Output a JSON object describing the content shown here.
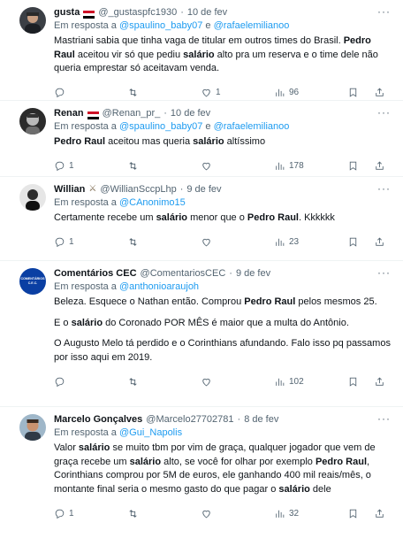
{
  "tweets": [
    {
      "name": "gusta",
      "handle": "@_gustaspfc1930",
      "sep": "·",
      "date": "10 de fev",
      "reply_prefix": "Em resposta a",
      "reply_to_1": "@spaulino_baby07",
      "reply_and": "e",
      "reply_to_2": "@rafaelemilianoo",
      "text": [
        "Mastriani sabia que tinha vaga de titular em outros times do Brasil. ",
        "Pedro Raul",
        " aceitou vir só que pediu ",
        "salário",
        " alto pra um reserva e o time dele não queria emprestar só aceitavam venda."
      ],
      "replies": "",
      "retweets": "",
      "likes": "1",
      "views": "96"
    },
    {
      "name": "Renan",
      "handle": "@Renan_pr_",
      "sep": "·",
      "date": "10 de fev",
      "reply_prefix": "Em resposta a",
      "reply_to_1": "@spaulino_baby07",
      "reply_and": "e",
      "reply_to_2": "@rafaelemilianoo",
      "text": [
        "Pedro Raul",
        " aceitou mas queria ",
        "salário",
        " altíssimo"
      ],
      "replies": "1",
      "retweets": "",
      "likes": "",
      "views": "178"
    },
    {
      "name": "Willian",
      "handle": "@WillianSccpLhp",
      "sep": "·",
      "date": "9 de fev",
      "reply_prefix": "Em resposta a",
      "reply_to_1": "@CAnonimo15",
      "text": [
        "Certamente recebe um ",
        "salário",
        " menor que o ",
        "Pedro Raul",
        ". Kkkkkk"
      ],
      "replies": "1",
      "retweets": "",
      "likes": "",
      "views": "23"
    },
    {
      "name": "Comentários CEC",
      "handle": "@ComentariosCEC",
      "sep": "·",
      "date": "9 de fev",
      "reply_prefix": "Em resposta a",
      "reply_to_1": "@anthonioaraujoh",
      "avatar_label": "COMENTÁRIOS C.E.C.",
      "p1": [
        "Beleza. Esquece o Nathan então. Comprou ",
        "Pedro Raul",
        " pelos mesmos 25."
      ],
      "p2": [
        "E o ",
        "salário",
        " do Coronado POR MÊS é maior que a multa do Antônio."
      ],
      "p3": "O Augusto Melo tá perdido e o Corinthians afundando. Falo isso pq passamos por isso aqui  em 2019.",
      "replies": "",
      "retweets": "",
      "likes": "",
      "views": "102"
    },
    {
      "name": "Marcelo Gonçalves",
      "handle": "@Marcelo27702781",
      "sep": "·",
      "date": "8 de fev",
      "reply_prefix": "Em resposta a",
      "reply_to_1": "@Gui_Napolis",
      "text": [
        "Valor ",
        "salário",
        " se muito tbm por vim de graça, qualquer jogador que vem de graça recebe um ",
        "salário",
        " alto, se você for olhar por exemplo ",
        "Pedro Raul",
        ", Corinthians comprou por 5M de euros, ele ganhando 400 mil reais/mês, o montante final seria o mesmo gasto do que pagar o ",
        "salário",
        " dele"
      ],
      "replies": "1",
      "retweets": "",
      "likes": "",
      "views": "32"
    }
  ],
  "icons": {
    "more": "more-icon",
    "reply": "reply-icon",
    "retweet": "retweet-icon",
    "like": "heart-icon",
    "views": "views-icon",
    "bookmark": "bookmark-icon",
    "share": "share-icon"
  },
  "colors": {
    "link": "#1d9bf0",
    "secondary": "#536471",
    "text": "#0f1419",
    "divider": "#eff3f4"
  }
}
